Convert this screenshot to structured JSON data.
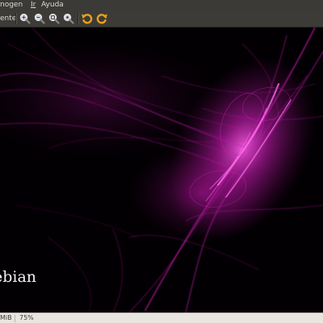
{
  "menu": {
    "items": [
      {
        "label": "nogen",
        "mnemonic": ""
      },
      {
        "label": "Ir",
        "mnemonic": ""
      },
      {
        "label": "Ayuda",
        "mnemonic": ""
      }
    ]
  },
  "toolbar": {
    "label": "ente",
    "tools": [
      {
        "icon": "zoom-in-icon"
      },
      {
        "icon": "zoom-out-icon"
      },
      {
        "icon": "zoom-fit-icon"
      },
      {
        "icon": "zoom-original-icon"
      },
      {
        "icon": "rotate-left-icon"
      },
      {
        "icon": "rotate-right-icon"
      }
    ]
  },
  "image": {
    "brand_text": "ebian",
    "accent_color": "#e020c8"
  },
  "status": {
    "size": "MiB",
    "zoom": "75%"
  }
}
